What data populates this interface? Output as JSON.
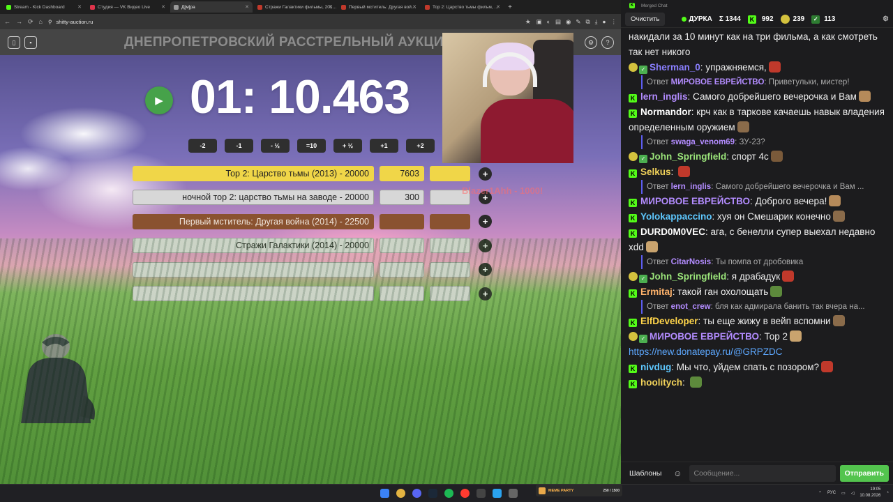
{
  "browser": {
    "tabs": [
      {
        "title": "Stream - Kick Dashboard",
        "color": "#53fc18",
        "active": false
      },
      {
        "title": "Студия — VK Видео Live",
        "color": "#e0344b",
        "active": false
      },
      {
        "title": "Д[м]ра",
        "color": "#9a9a9a",
        "active": true
      },
      {
        "title": "Стражи Галактики фильмы, 201…",
        "color": "#c1392b",
        "active": false
      },
      {
        "title": "Первый мститель: Другая вой…",
        "color": "#c1392b",
        "active": false
      },
      {
        "title": "Тор 2: Царство тьмы фильм, …",
        "color": "#c1392b",
        "active": false
      }
    ],
    "new_tab": "+",
    "url": "shitty-auction.ru",
    "window_controls": [
      "—",
      "□",
      "✕"
    ]
  },
  "auction": {
    "title": "ДНЕПРОПЕТРОВСКИЙ РАССТРЕЛЬНЫЙ АУКЦИОН",
    "timer": "01: 10.463",
    "adjust_buttons": [
      "-2",
      "-1",
      "- ½",
      "=10",
      "+ ½",
      "+1",
      "+2"
    ],
    "lots": [
      {
        "name": "Тор 2: Царство тьмы (2013) - 20000",
        "sum": "7603",
        "color": "#f0d648"
      },
      {
        "name": "ночной тор 2: царство тьмы на заводе - 20000",
        "sum": "300",
        "color": "#d7d7d7"
      },
      {
        "name": "Первый мститель: Другая война (2014) - 22500",
        "sum": "",
        "color": "#8a5230"
      },
      {
        "name": "Стражи Галактики (2014) - 20000",
        "sum": "",
        "color": "#d7d7d7"
      },
      {
        "name": "",
        "sum": "",
        "color": "#d7d7d7"
      },
      {
        "name": "",
        "sum": "",
        "color": "#d7d7d7"
      }
    ],
    "floating_donation": "Blazer1Ahh - 1000!",
    "plus_label": "+"
  },
  "chat": {
    "window_title": "Merged Chat",
    "clear_button": "Очистить",
    "channel": "ДУРКА",
    "stats": {
      "total": "Σ 1344",
      "kick": "992",
      "other": "239",
      "third": "113"
    },
    "messages": [
      {
        "type": "cont",
        "text": "накидали за 10 минут как на три фильма, а как смотреть так нет никого"
      },
      {
        "type": "msg",
        "user": "Sherman_0",
        "color": "#8a7fff",
        "badge": "emote",
        "text": "упражняемся,"
      },
      {
        "type": "reply",
        "user": "МИРОВОЕ ЕВРЕЙСТВО",
        "text": "Приветульки, мистер!"
      },
      {
        "type": "msg",
        "user": "lern_inglis",
        "color": "#b38cff",
        "badge": "kick",
        "text": "Самого добрейшего вечерочка и Вам"
      },
      {
        "type": "msg",
        "user": "Normandor",
        "color": "#ffffff",
        "badge": "kick",
        "text": "крч как в таркове качаешь навык владения определенным оружием"
      },
      {
        "type": "reply",
        "user": "swaga_venom69",
        "text": "ЗУ-23?"
      },
      {
        "type": "msg",
        "user": "John_Springfield",
        "color": "#9be57a",
        "badge": "emote",
        "text": "спорт 4с"
      },
      {
        "type": "msg",
        "user": "Selkus",
        "color": "#f1d25a",
        "badge": "kick",
        "text": ""
      },
      {
        "type": "reply",
        "user": "lern_inglis",
        "text": "Самого добрейшего вечерочка и Вам ..."
      },
      {
        "type": "msg",
        "user": "МИРОВОЕ ЕВРЕЙСТВО",
        "color": "#b38cff",
        "badge": "kick",
        "text": "Доброго вечера!"
      },
      {
        "type": "msg",
        "user": "Yolokappaccino",
        "color": "#5ec8ff",
        "badge": "kick",
        "text": "хуя он Смешарик конечно"
      },
      {
        "type": "msg",
        "user": "DURD0M0VEC",
        "color": "#ffffff",
        "badge": "kick",
        "text": "ага, с бенелли супер выехал недавно xdd"
      },
      {
        "type": "reply",
        "user": "CitarNosis",
        "text": "Ты помпа от дробовика"
      },
      {
        "type": "msg",
        "user": "John_Springfield",
        "color": "#9be57a",
        "badge": "emote",
        "text": "я драбадук"
      },
      {
        "type": "msg",
        "user": "Ermitaj",
        "color": "#ffb26b",
        "badge": "kick",
        "text": "такой ган охолощать"
      },
      {
        "type": "reply",
        "user": "enot_crew",
        "text": "бля как адмирала банить так вчера на..."
      },
      {
        "type": "msg",
        "user": "ElfDeveloper",
        "color": "#ffd54a",
        "badge": "kick",
        "text": "ты еще жижу в вейп вспомни"
      },
      {
        "type": "msg",
        "user": "МИРОВОЕ ЕВРЕЙСТВО",
        "color": "#b38cff",
        "badge": "emote",
        "text": "Тор 2"
      },
      {
        "type": "link",
        "text": "https://new.donatepay.ru/@GRPZDC"
      },
      {
        "type": "msg",
        "user": "nivdug",
        "color": "#5ec8ff",
        "badge": "kick",
        "text": "Мы что, уйдем спать с позором?"
      },
      {
        "type": "msg",
        "user": "hoolitych",
        "color": "#f1d25a",
        "badge": "kick",
        "text": ""
      }
    ],
    "templates_button": "Шаблоны",
    "emoji_button": "☺",
    "message_placeholder": "Сообщение...",
    "send_button": "Отправить"
  },
  "taskbar": {
    "meme_party_label": "MEME PARTY",
    "meme_party_count": "250 / 1500",
    "lang": "РУС",
    "time": "19:05",
    "date": "10.08.2026"
  }
}
